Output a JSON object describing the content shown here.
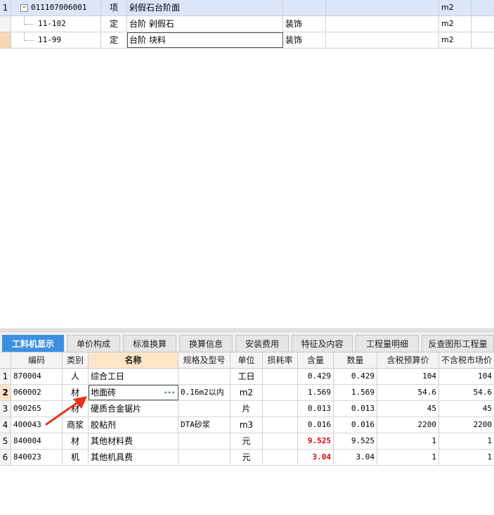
{
  "top_table": {
    "rows": [
      {
        "num": "1",
        "code": "011107006001",
        "type": "项",
        "name": "剁假石台阶面",
        "profession": "",
        "feature": "",
        "unit": "m2",
        "extra": ""
      },
      {
        "num": "",
        "code": "11-102",
        "type": "定",
        "name": "台阶 剁假石",
        "profession": "装饰",
        "feature": "",
        "unit": "m2",
        "extra": ""
      },
      {
        "num": "",
        "code": "11-99",
        "type": "定",
        "name": "台阶 块料",
        "profession": "装饰",
        "feature": "",
        "unit": "m2",
        "extra": ""
      }
    ],
    "expand_glyph": "−"
  },
  "tabs": [
    {
      "label": "工料机显示",
      "active": true
    },
    {
      "label": "单价构成",
      "active": false
    },
    {
      "label": "标准换算",
      "active": false
    },
    {
      "label": "换算信息",
      "active": false
    },
    {
      "label": "安装费用",
      "active": false
    },
    {
      "label": "特征及内容",
      "active": false
    },
    {
      "label": "工程量明细",
      "active": false
    },
    {
      "label": "反查图形工程量",
      "active": false
    }
  ],
  "bottom_table": {
    "headers": {
      "code": "编码",
      "category": "类别",
      "name": "名称",
      "spec": "规格及型号",
      "unit": "单位",
      "loss": "损耗率",
      "content": "含量",
      "quantity": "数量",
      "tax_budget_price": "含税预算价",
      "no_tax_market_price": "不含税市场价"
    },
    "rows": [
      {
        "num": "1",
        "code": "870004",
        "category": "人",
        "name": "综合工日",
        "spec": "",
        "unit": "工日",
        "loss": "",
        "content": "0.429",
        "quantity": "0.429",
        "tax_budget_price": "104",
        "no_tax_market_price": "104"
      },
      {
        "num": "2",
        "code": "060002",
        "category": "材",
        "name": "地面砖",
        "spec": "0.16m2以内",
        "unit": "m2",
        "loss": "",
        "content": "1.569",
        "quantity": "1.569",
        "tax_budget_price": "54.6",
        "no_tax_market_price": "54.6"
      },
      {
        "num": "3",
        "code": "090265",
        "category": "材",
        "name": "硬质合金锯片",
        "spec": "",
        "unit": "片",
        "loss": "",
        "content": "0.013",
        "quantity": "0.013",
        "tax_budget_price": "45",
        "no_tax_market_price": "45"
      },
      {
        "num": "4",
        "code": "400043",
        "category": "商浆",
        "name": "胶粘剂",
        "spec": "DTA砂浆",
        "unit": "m3",
        "loss": "",
        "content": "0.016",
        "quantity": "0.016",
        "tax_budget_price": "2200",
        "no_tax_market_price": "2200"
      },
      {
        "num": "5",
        "code": "840004",
        "category": "材",
        "name": "其他材料费",
        "spec": "",
        "unit": "元",
        "loss": "",
        "content": "9.525",
        "quantity": "9.525",
        "tax_budget_price": "1",
        "no_tax_market_price": "1"
      },
      {
        "num": "6",
        "code": "840023",
        "category": "机",
        "name": "其他机具费",
        "spec": "",
        "unit": "元",
        "loss": "",
        "content": "3.04",
        "quantity": "3.04",
        "tax_budget_price": "1",
        "no_tax_market_price": "1"
      }
    ],
    "ellipsis": "···"
  },
  "colors": {
    "active_tab": "#3c8fe3",
    "selected_row": "#dce6f8",
    "header_highlight": "#fde6c8",
    "emphasis_value": "#e00000",
    "annotation_arrow": "#e8321e"
  }
}
